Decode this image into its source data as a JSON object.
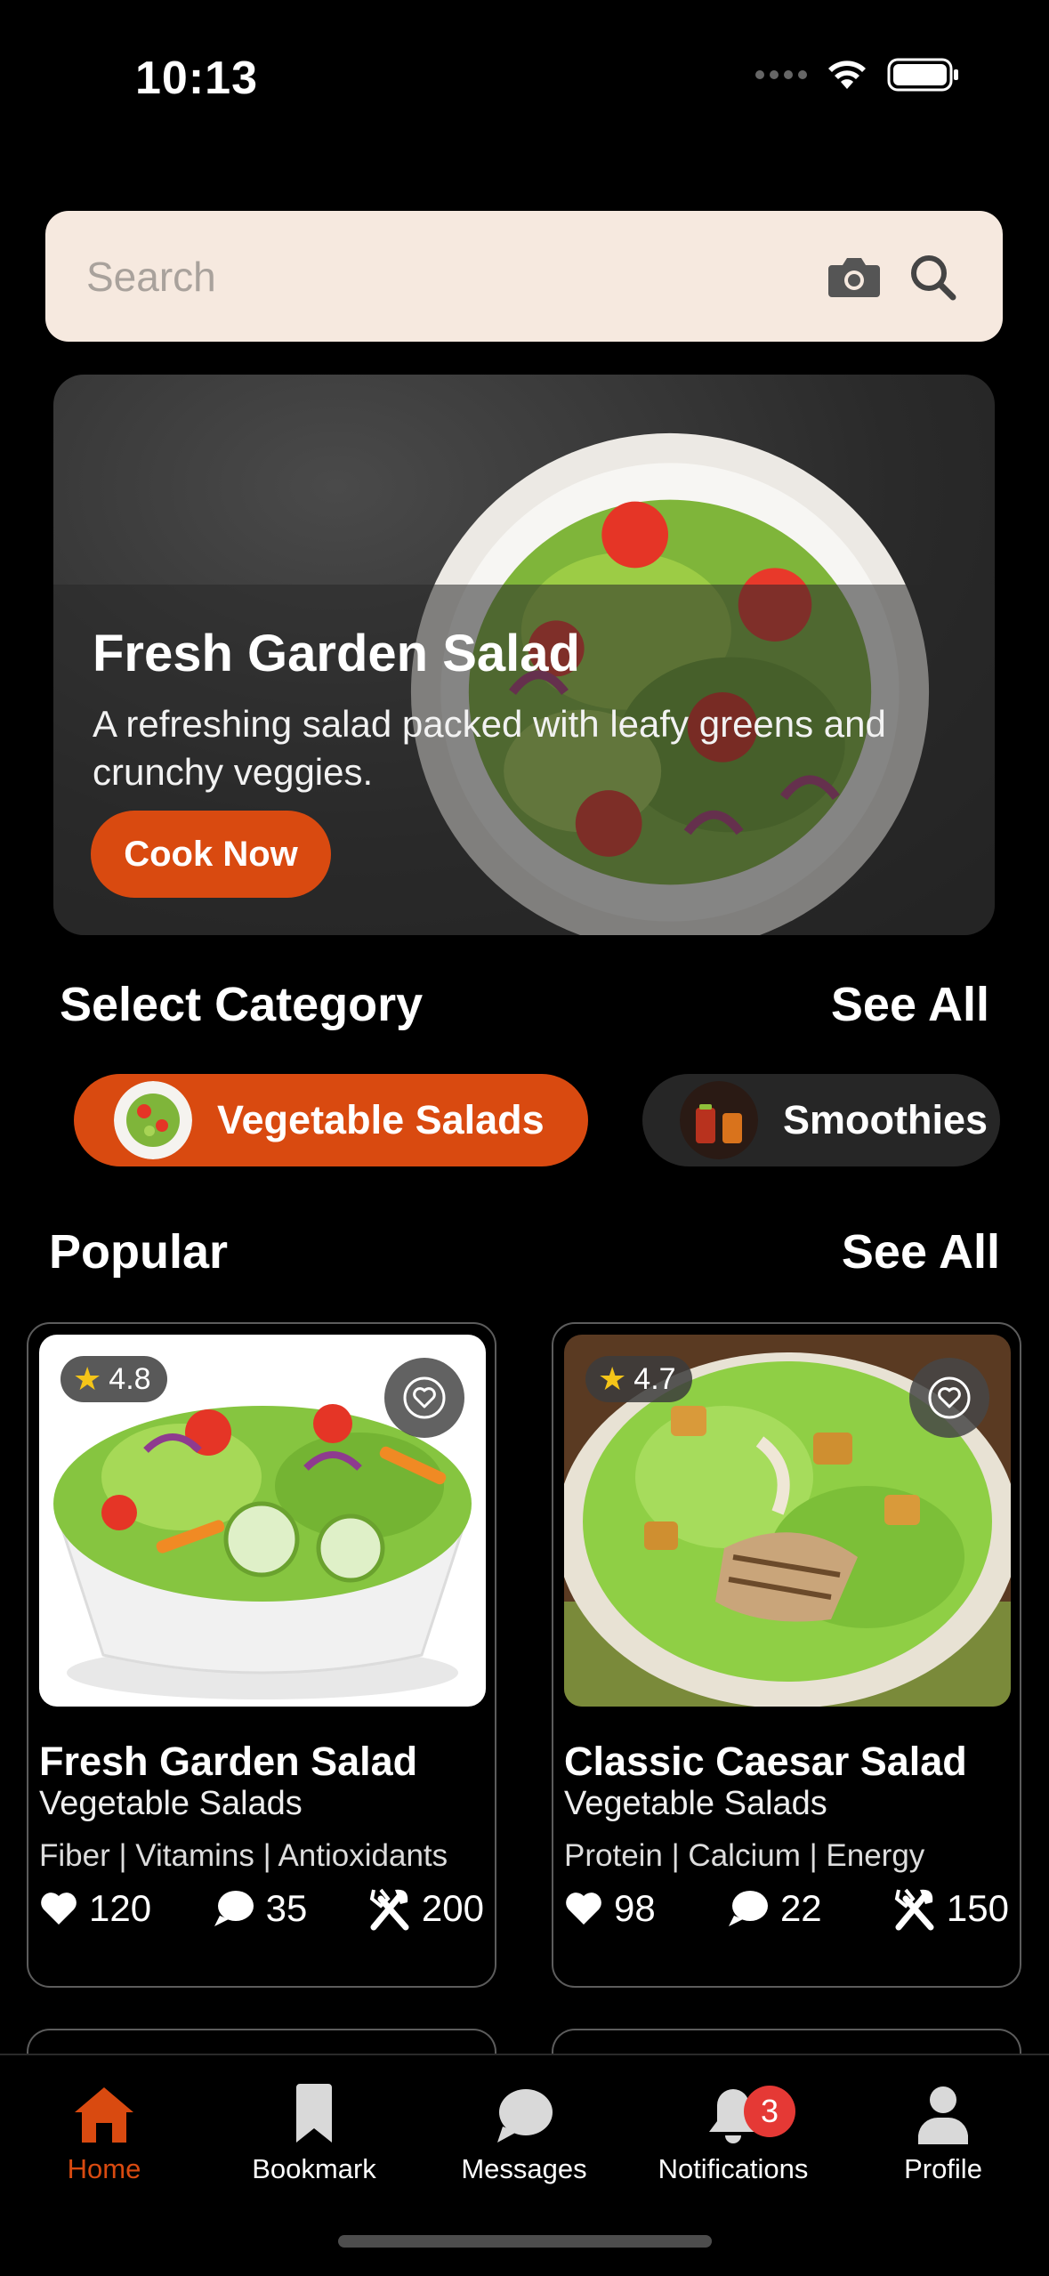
{
  "status_bar": {
    "time": "10:13"
  },
  "search": {
    "placeholder": "Search"
  },
  "hero": {
    "title": "Fresh Garden Salad",
    "description": "A refreshing salad packed with leafy greens and crunchy veggies.",
    "button": "Cook Now"
  },
  "category_section": {
    "title": "Select Category",
    "see_all": "See All"
  },
  "categories": [
    {
      "label": "Vegetable Salads",
      "active": true
    },
    {
      "label": "Smoothies &",
      "active": false
    }
  ],
  "popular_section": {
    "title": "Popular",
    "see_all": "See All"
  },
  "cards": [
    {
      "rating": "4.8",
      "title": "Fresh Garden Salad",
      "category": "Vegetable Salads",
      "tags": "Fiber | Vitamins | Antioxidants",
      "likes": "120",
      "comments": "35",
      "servings": "200"
    },
    {
      "rating": "4.7",
      "title": "Classic Caesar Salad",
      "category": "Vegetable Salads",
      "tags": "Protein | Calcium | Energy",
      "likes": "98",
      "comments": "22",
      "servings": "150"
    }
  ],
  "nav": {
    "items": [
      {
        "label": "Home",
        "icon": "home-icon",
        "active": true
      },
      {
        "label": "Bookmark",
        "icon": "bookmark-icon"
      },
      {
        "label": "Messages",
        "icon": "chat-icon"
      },
      {
        "label": "Notifications",
        "icon": "bell-icon",
        "badge": "3"
      },
      {
        "label": "Profile",
        "icon": "person-icon"
      }
    ]
  },
  "colors": {
    "accent": "#d94a10",
    "search_bg": "#f6e9df",
    "badge": "#e53935",
    "background": "#000000"
  }
}
